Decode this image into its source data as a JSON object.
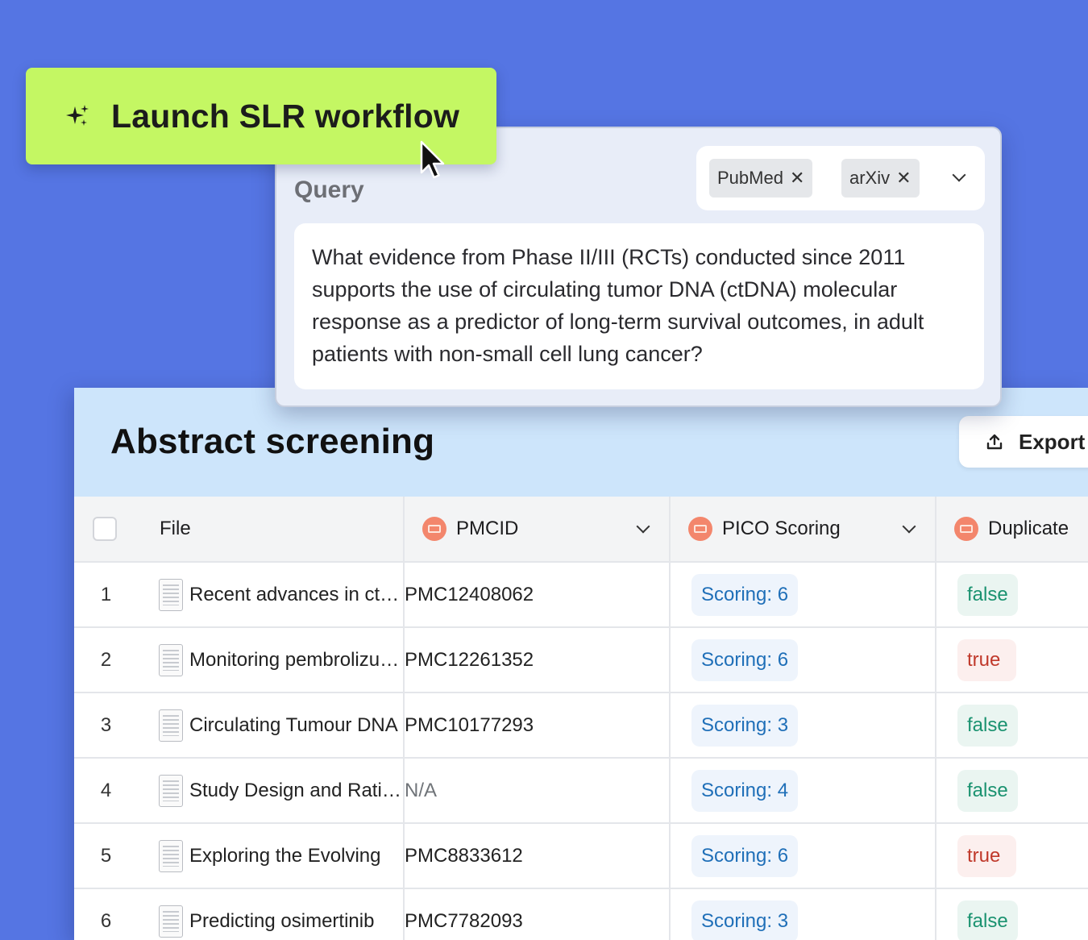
{
  "launch": {
    "label": "Launch SLR workflow",
    "icon": "sparkle-icon",
    "color": "#c4f763"
  },
  "query": {
    "label": "Query",
    "sources": [
      "PubMed",
      "arXiv"
    ],
    "text": "What evidence from Phase II/III (RCTs) conducted since 2011 supports the use of circulating tumor DNA (ctDNA) molecular response as a predictor of long-term survival outcomes, in adult patients with non-small cell lung cancer?"
  },
  "screening": {
    "title": "Abstract screening",
    "export_label": "Export",
    "columns": {
      "file": "File",
      "pmcid": "PMCID",
      "pico": "PICO Scoring",
      "duplicate": "Duplicate"
    },
    "rows": [
      {
        "num": "1",
        "file": "Recent advances in ctDNA",
        "pmcid": "PMC12408062",
        "score": "Scoring: 6",
        "duplicate": "false"
      },
      {
        "num": "2",
        "file": "Monitoring pembrolizumab",
        "pmcid": "PMC12261352",
        "score": "Scoring: 6",
        "duplicate": "true"
      },
      {
        "num": "3",
        "file": "Circulating Tumour DNA",
        "pmcid": "PMC10177293",
        "score": "Scoring: 3",
        "duplicate": "false"
      },
      {
        "num": "4",
        "file": "Study Design and Rationale",
        "pmcid": "N/A",
        "score": "Scoring: 4",
        "duplicate": "false"
      },
      {
        "num": "5",
        "file": "Exploring the Evolving",
        "pmcid": "PMC8833612",
        "score": "Scoring: 6",
        "duplicate": "true"
      },
      {
        "num": "6",
        "file": "Predicting osimertinib",
        "pmcid": "PMC7782093",
        "score": "Scoring: 3",
        "duplicate": "false"
      }
    ]
  },
  "colors": {
    "background": "#5575e3",
    "header_band": "#cde5fb",
    "score": "#1f6fb8",
    "false": "#1a9270",
    "true": "#c0392b"
  }
}
